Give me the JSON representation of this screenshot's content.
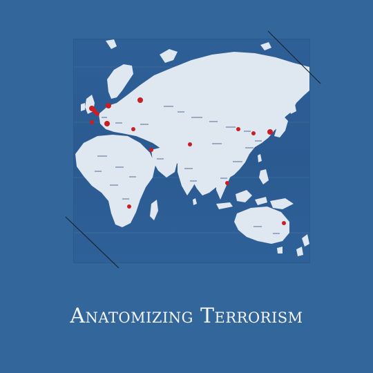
{
  "cover": {
    "title": "Anatomizing Terrorism",
    "colors": {
      "background": "#33669a",
      "ocean": "#2c5c93",
      "land": "#dfe7f1",
      "pin": "#c81e24",
      "title_text": "#f4f6fa",
      "deco_line": "#1b2430"
    },
    "map": {
      "image": "world-map-with-pins",
      "pin_icon": "map-pin-icon"
    }
  }
}
